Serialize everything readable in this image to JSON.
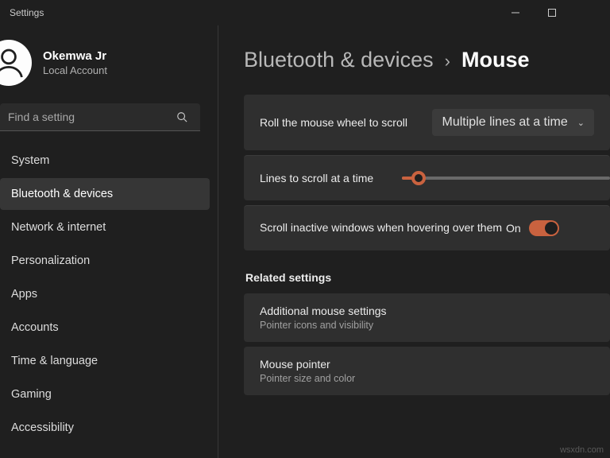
{
  "window": {
    "title": "Settings"
  },
  "user": {
    "name": "Okemwa Jr",
    "account": "Local Account"
  },
  "search": {
    "placeholder": "Find a setting"
  },
  "sidebar": {
    "items": [
      {
        "label": "System"
      },
      {
        "label": "Bluetooth & devices"
      },
      {
        "label": "Network & internet"
      },
      {
        "label": "Personalization"
      },
      {
        "label": "Apps"
      },
      {
        "label": "Accounts"
      },
      {
        "label": "Time & language"
      },
      {
        "label": "Gaming"
      },
      {
        "label": "Accessibility"
      }
    ],
    "active_index": 1
  },
  "breadcrumb": {
    "parent": "Bluetooth & devices",
    "sep": "›",
    "leaf": "Mouse"
  },
  "settings": {
    "scrollwheel": {
      "label": "Roll the mouse wheel to scroll",
      "value": "Multiple lines at a time"
    },
    "lines": {
      "label": "Lines to scroll at a time"
    },
    "inactive": {
      "label": "Scroll inactive windows when hovering over them",
      "state": "On"
    }
  },
  "related": {
    "heading": "Related settings",
    "items": [
      {
        "title": "Additional mouse settings",
        "sub": "Pointer icons and visibility"
      },
      {
        "title": "Mouse pointer",
        "sub": "Pointer size and color"
      }
    ]
  },
  "watermark": "wsxdn.com"
}
